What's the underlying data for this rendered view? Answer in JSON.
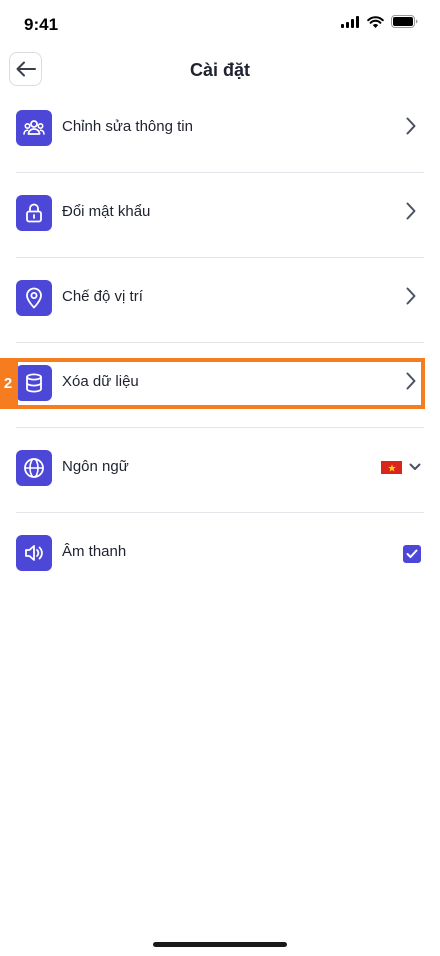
{
  "status": {
    "time": "9:41"
  },
  "header": {
    "title": "Cài đặt"
  },
  "settings": {
    "items": [
      {
        "label": "Chỉnh sửa thông tin",
        "icon": "users-icon"
      },
      {
        "label": "Đổi mật khẩu",
        "icon": "lock-icon"
      },
      {
        "label": "Chế độ vị trí",
        "icon": "location-pin-icon"
      },
      {
        "label": "Xóa dữ liệu",
        "icon": "database-icon"
      },
      {
        "label": "Ngôn ngữ",
        "icon": "globe-icon",
        "value_icon": "vietnam-flag-icon"
      },
      {
        "label": "Âm thanh",
        "icon": "speaker-icon",
        "checked": true
      }
    ]
  },
  "annotation": {
    "number": "2",
    "color": "#f57c1f"
  },
  "colors": {
    "accent": "#4d47d8",
    "divider": "#e3e5ea"
  }
}
